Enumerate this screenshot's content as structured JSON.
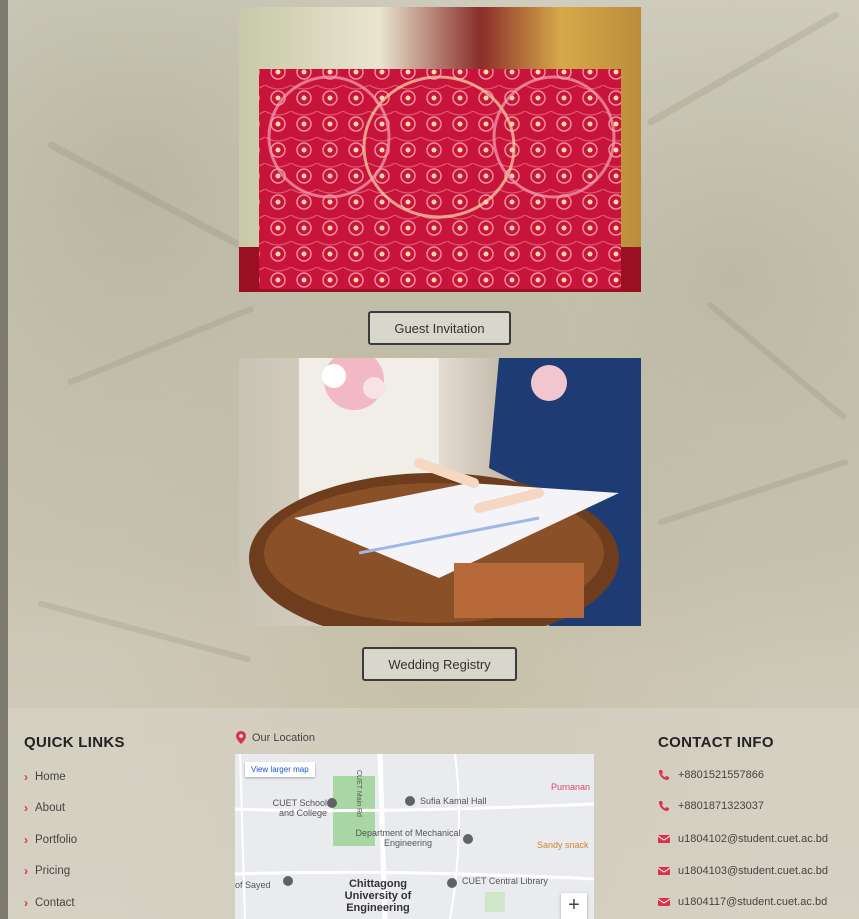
{
  "services": [
    {
      "label": "Guest Invitation"
    },
    {
      "label": "Wedding Registry"
    }
  ],
  "footer": {
    "quick_links": {
      "title": "QUICK LINKS",
      "items": [
        "Home",
        "About",
        "Portfolio",
        "Pricing",
        "Contact"
      ]
    },
    "location": {
      "label": "Our Location",
      "view_larger_map": "View larger map",
      "map_labels": {
        "cuet_school": "CUET School and College",
        "sufia_hall": "Sufia Kamal Hall",
        "dept_me": "Department of Mechanical Engineering",
        "cuet_library": "CUET Central Library",
        "chittagong_univ": "Chittagong University of Engineering",
        "of_sayed": "of Sayed",
        "sandy_snack": "Sandy snack",
        "purnanan": "Purnanan",
        "cuet_main_rd": "CUET Main Rd"
      },
      "zoom_in": "+"
    },
    "contact_info": {
      "title": "CONTACT INFO",
      "phones": [
        "+8801521557866",
        "+8801871323037"
      ],
      "emails": [
        "u1804102@student.cuet.ac.bd",
        "u1804103@student.cuet.ac.bd",
        "u1804117@student.cuet.ac.bd"
      ]
    }
  },
  "colors": {
    "accent": "#d9334a",
    "map_link": "#1a55c4"
  }
}
